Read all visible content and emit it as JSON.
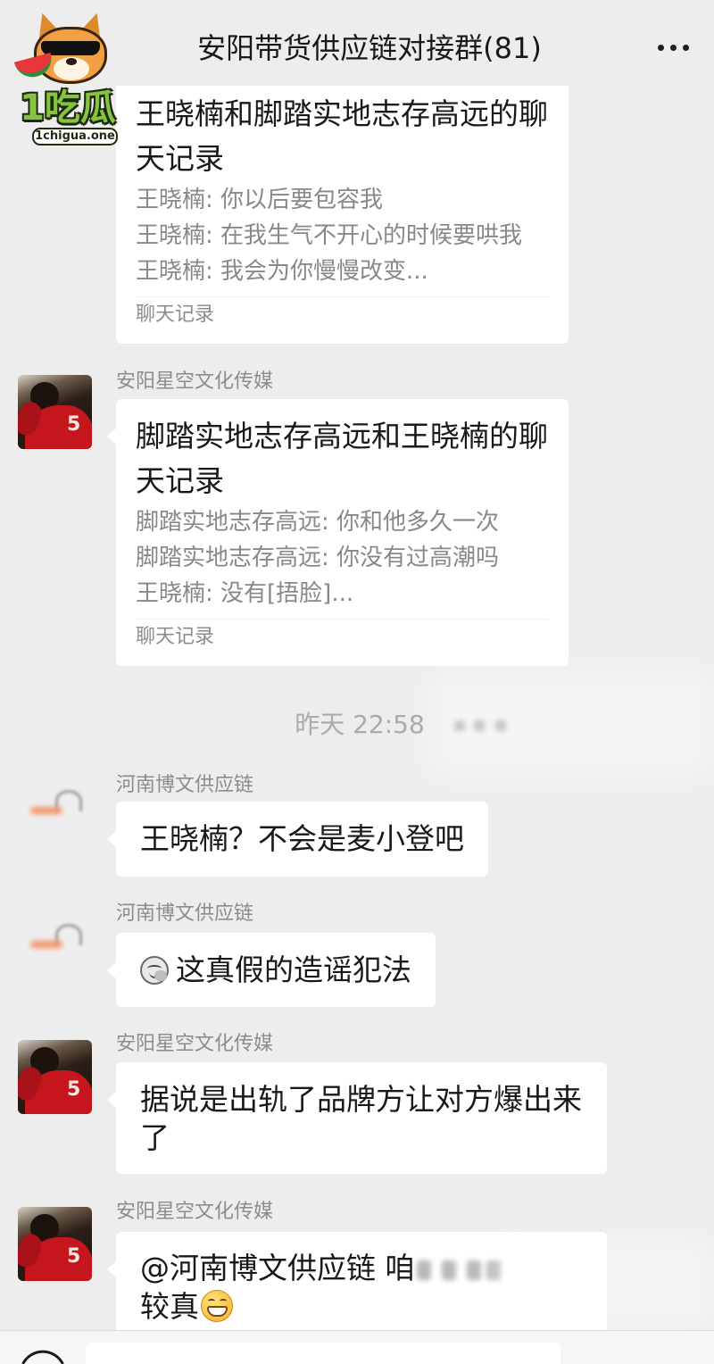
{
  "watermark": {
    "brand": "1吃瓜",
    "domain": "1chigua.one",
    "icon": "dog-mascot-icon"
  },
  "header": {
    "title": "安阳带货供应链对接群(81)",
    "more_icon": "more-icon"
  },
  "chat_records": [
    {
      "title": "王晓楠和脚踏实地志存高远的聊天记录",
      "preview": [
        "王晓楠: 你以后要包容我",
        "王晓楠: 在我生气不开心的时候要哄我",
        "王晓楠: 我会为你慢慢改变..."
      ],
      "footer": "聊天记录"
    },
    {
      "sender": "安阳星空文化传媒",
      "title": "脚踏实地志存高远和王晓楠的聊天记录",
      "preview": [
        "脚踏实地志存高远: 你和他多久一次",
        "脚踏实地志存高远: 你没有过高潮吗",
        "王晓楠: 没有[捂脸]..."
      ],
      "footer": "聊天记录"
    }
  ],
  "timestamp": "昨天 22:58",
  "messages": [
    {
      "sender": "河南博文供应链",
      "text": "王晓楠？不会是麦小登吧"
    },
    {
      "sender": "河南博文供应链",
      "icon": "face-sticker-icon",
      "text": "这真假的造谣犯法"
    },
    {
      "sender": "安阳星空文化传媒",
      "text": "据说是出轨了品牌方让对方爆出来了"
    },
    {
      "sender": "安阳星空文化传媒",
      "mention": "@河南博文供应链",
      "text_start": "咱",
      "text_end": "较真",
      "emoji": "grinning-face-icon"
    }
  ],
  "avatar": {
    "jersey_number": "5"
  },
  "input_bar": {
    "voice_icon": "voice-icon"
  },
  "colors": {
    "background": "#ededed",
    "bubble": "#ffffff",
    "primary_text": "#191919",
    "secondary_text": "#8c8c8c",
    "brand_green": "#86c43f"
  }
}
